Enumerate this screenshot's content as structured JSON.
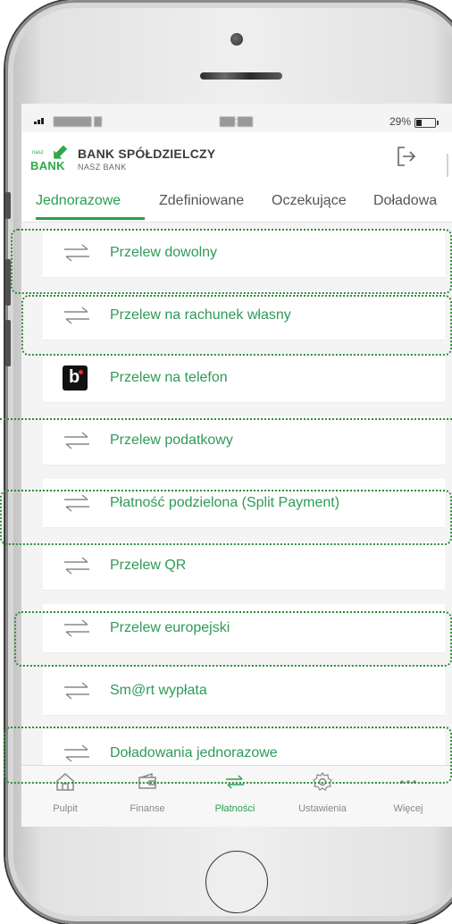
{
  "status": {
    "battery": "29%"
  },
  "bank": {
    "logo_small": "nasz",
    "logo_big": "BANK",
    "name": "BANK SPÓŁDZIELCZY",
    "subtitle": "NASZ BANK"
  },
  "tabs": [
    {
      "label": "Jednorazowe",
      "active": true
    },
    {
      "label": "Zdefiniowane"
    },
    {
      "label": "Oczekujące"
    },
    {
      "label": "Doładowa"
    }
  ],
  "items": [
    {
      "label": "Przelew dowolny",
      "icon": "transfer-arrows-icon"
    },
    {
      "label": "Przelew na rachunek własny",
      "icon": "transfer-arrows-icon"
    },
    {
      "label": "Przelew na telefon",
      "icon": "blik-icon"
    },
    {
      "label": "Przelew podatkowy",
      "icon": "transfer-arrows-icon"
    },
    {
      "label": "Płatność podzielona (Split Payment)",
      "icon": "transfer-arrows-icon"
    },
    {
      "label": "Przelew QR",
      "icon": "transfer-arrows-icon"
    },
    {
      "label": "Przelew europejski",
      "icon": "transfer-arrows-icon"
    },
    {
      "label": "Sm@rt wypłata",
      "icon": "transfer-arrows-icon"
    },
    {
      "label": "Doładowania jednorazowe",
      "icon": "transfer-arrows-icon"
    }
  ],
  "tabbar": [
    {
      "label": "Pulpit",
      "icon": "home-icon"
    },
    {
      "label": "Finanse",
      "icon": "wallet-icon"
    },
    {
      "label": "Płatności",
      "icon": "transfer-arrows-icon",
      "active": true
    },
    {
      "label": "Ustawienia",
      "icon": "gear-icon"
    },
    {
      "label": "Więcej",
      "icon": "more-dots-icon"
    }
  ],
  "colors": {
    "accent": "#28a050",
    "highlight": "#2e8b3a"
  }
}
